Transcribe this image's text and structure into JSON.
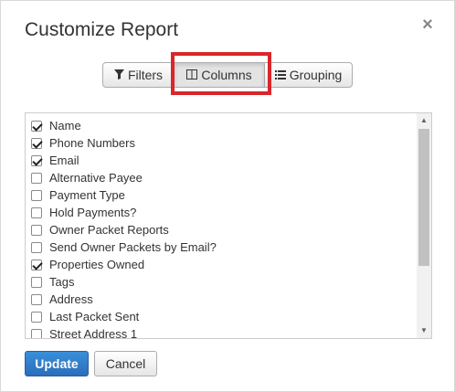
{
  "dialog": {
    "title": "Customize Report",
    "close_glyph": "×"
  },
  "tabs": [
    {
      "label": "Filters",
      "icon": "filter-icon"
    },
    {
      "label": "Columns",
      "icon": "columns-icon",
      "active": true
    },
    {
      "label": "Grouping",
      "icon": "list-icon"
    }
  ],
  "columns": [
    {
      "label": "Name",
      "checked": true
    },
    {
      "label": "Phone Numbers",
      "checked": true
    },
    {
      "label": "Email",
      "checked": true
    },
    {
      "label": "Alternative Payee",
      "checked": false
    },
    {
      "label": "Payment Type",
      "checked": false
    },
    {
      "label": "Hold Payments?",
      "checked": false
    },
    {
      "label": "Owner Packet Reports",
      "checked": false
    },
    {
      "label": "Send Owner Packets by Email?",
      "checked": false
    },
    {
      "label": "Properties Owned",
      "checked": true
    },
    {
      "label": "Tags",
      "checked": false
    },
    {
      "label": "Address",
      "checked": false
    },
    {
      "label": "Last Packet Sent",
      "checked": false
    },
    {
      "label": "Street Address 1",
      "checked": false
    }
  ],
  "buttons": {
    "update_label": "Update",
    "cancel_label": "Cancel"
  },
  "colors": {
    "highlight": "#d9262b",
    "primary": "#2a6ebb"
  }
}
